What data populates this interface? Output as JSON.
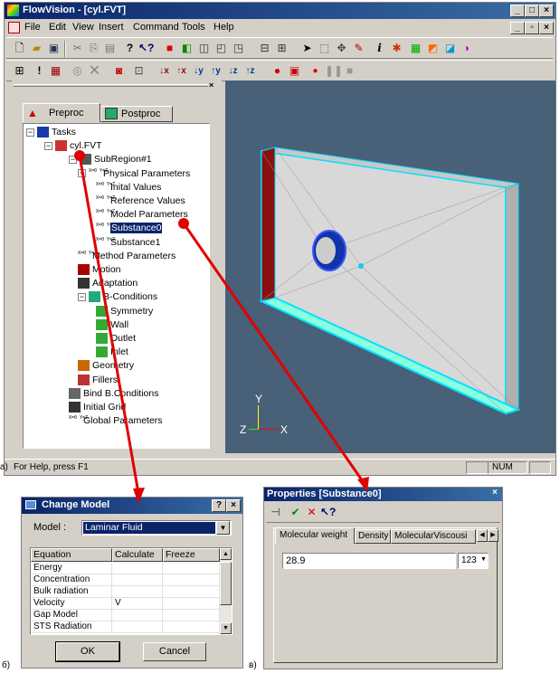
{
  "main_window": {
    "title": "FlowVision - [cyl.FVT]",
    "menu": [
      "File",
      "Edit",
      "View",
      "Insert",
      "Command",
      "Tools",
      "Help"
    ],
    "tabs": [
      "Preproc",
      "Postproc"
    ],
    "tree": [
      {
        "label": "Tasks",
        "depth": 0,
        "icon": "tasks-icon"
      },
      {
        "label": "cyl.FVT",
        "depth": 1,
        "icon": "project-icon"
      },
      {
        "label": "SubRegion#1",
        "depth": 2,
        "icon": "subregion-icon"
      },
      {
        "label": "Physical Parameters",
        "depth": 3,
        "icon": "xyz-icon"
      },
      {
        "label": "Inital Values",
        "depth": 4,
        "icon": "xyz-icon"
      },
      {
        "label": "Reference Values",
        "depth": 4,
        "icon": "xyz-icon"
      },
      {
        "label": "Model Parameters",
        "depth": 4,
        "icon": "xyz-icon"
      },
      {
        "label": "Substance0",
        "depth": 4,
        "icon": "xyz-icon",
        "selected": true
      },
      {
        "label": "Substance1",
        "depth": 4,
        "icon": "xyz-icon"
      },
      {
        "label": "Method Parameters",
        "depth": 3,
        "icon": "xyz-icon"
      },
      {
        "label": "Motion",
        "depth": 3,
        "icon": "motion-icon"
      },
      {
        "label": "Adaptation",
        "depth": 3,
        "icon": "grid-icon"
      },
      {
        "label": "B-Conditions",
        "depth": 3,
        "icon": "bc-icon"
      },
      {
        "label": "Symmetry",
        "depth": 4,
        "icon": "bc-item-icon"
      },
      {
        "label": "Wall",
        "depth": 4,
        "icon": "bc-item-icon"
      },
      {
        "label": "Outlet",
        "depth": 4,
        "icon": "bc-item-icon"
      },
      {
        "label": "Inlet",
        "depth": 4,
        "icon": "bc-item-icon"
      },
      {
        "label": "Geometry",
        "depth": 3,
        "icon": "geometry-icon"
      },
      {
        "label": "Fillers",
        "depth": 3,
        "icon": "fillers-icon"
      },
      {
        "label": "Bind B.Conditions",
        "depth": 2,
        "icon": "bind-icon"
      },
      {
        "label": "Initial Grid",
        "depth": 2,
        "icon": "grid-icon"
      },
      {
        "label": "Global Parameters",
        "depth": 2,
        "icon": "xyz-icon"
      }
    ],
    "axes": {
      "y": "Y",
      "z": "Z",
      "x": "X"
    },
    "status_text": "For Help, press F1",
    "status_num": "NUM"
  },
  "labels": {
    "a": "a)",
    "b": "б)",
    "v": "в)"
  },
  "change_model": {
    "title": "Change Model",
    "model_label": "Model :",
    "model_value": "Laminar Fluid",
    "columns": [
      "Equation",
      "Calculate",
      "Freeze"
    ],
    "rows": [
      [
        "Energy",
        "",
        ""
      ],
      [
        "Concentration",
        "",
        ""
      ],
      [
        "Bulk radiation",
        "",
        ""
      ],
      [
        "Velocity",
        "V",
        ""
      ],
      [
        "Gap Model",
        "",
        ""
      ],
      [
        "STS Radiation",
        "",
        ""
      ]
    ],
    "ok": "OK",
    "cancel": "Cancel"
  },
  "properties": {
    "title": "Properties [Substance0]",
    "tabs": [
      "Molecular weight",
      "Density",
      "MolecularViscousi"
    ],
    "value": "28.9",
    "unit": "123"
  },
  "colors": {
    "title_bar": "#0a246a",
    "viewport": "#486078",
    "arrow": "#e00000",
    "selection": "#0a246a"
  }
}
